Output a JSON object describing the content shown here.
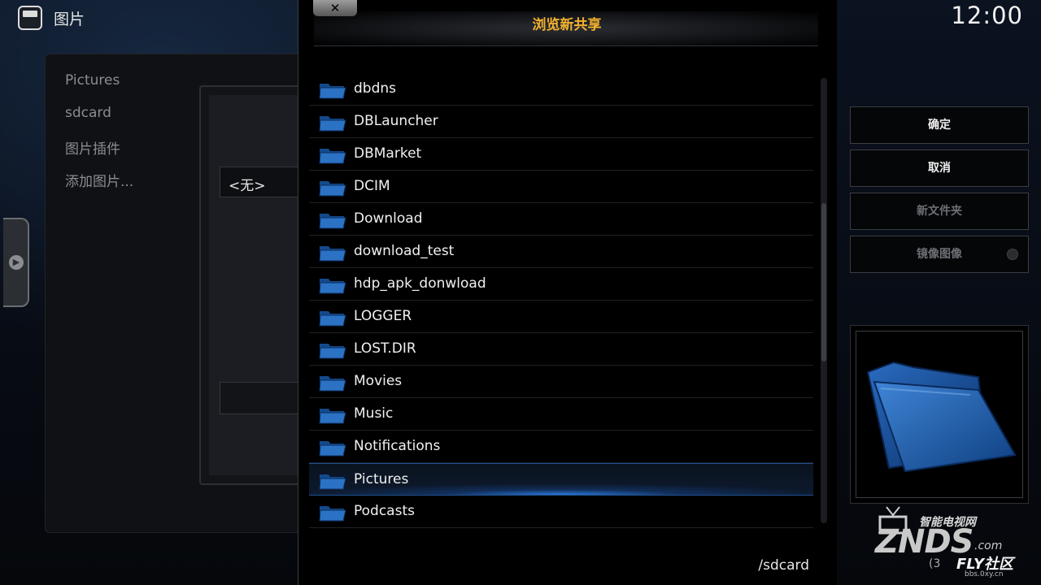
{
  "header": {
    "app_title": "图片",
    "clock": "12:00"
  },
  "left_panel": {
    "items": [
      "Pictures",
      "sdcard",
      "图片插件",
      "添加图片..."
    ],
    "source_value": "<无>"
  },
  "dialog": {
    "title": "浏览新共享",
    "close_icon": "close-icon",
    "current_path": "/sdcard",
    "selected_index": 12,
    "folders": [
      "dbdns",
      "DBLauncher",
      "DBMarket",
      "DCIM",
      "Download",
      "download_test",
      "hdp_apk_donwload",
      "LOGGER",
      "LOST.DIR",
      "Movies",
      "Music",
      "Notifications",
      "Pictures",
      "Podcasts"
    ]
  },
  "actions": {
    "ok": "确定",
    "cancel": "取消",
    "new_folder": "新文件夹",
    "mirror_image": "镜像图像"
  },
  "watermark": {
    "top": "智能电视网",
    "main": "ZNDS",
    "com": ".com",
    "fly": "FLY社区",
    "url": "bbs.0xy.cn",
    "paren": "(3"
  },
  "colors": {
    "title_accent": "#f2b12e",
    "folder_blue": "#1d5fa8",
    "selection_glow": "#2a78d8"
  }
}
